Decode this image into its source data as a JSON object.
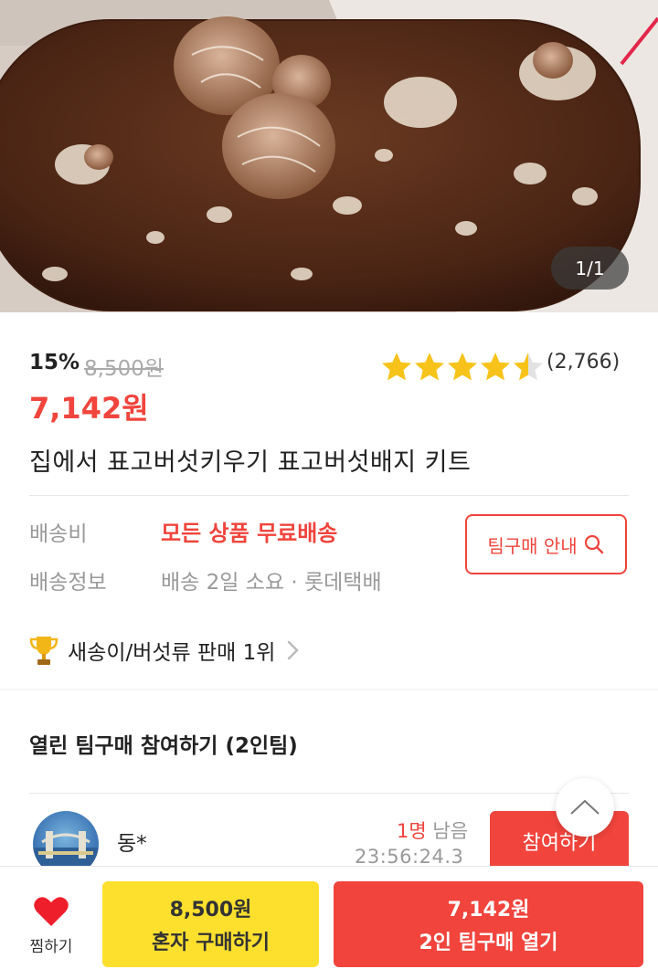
{
  "image": {
    "counter": "1/1"
  },
  "price": {
    "discount": "15%",
    "original": "8,500원",
    "sale": "7,142원"
  },
  "rating": {
    "stars": 4.5,
    "count": "(2,766)",
    "star_color": "#f7c31a"
  },
  "product": {
    "title": "집에서 표고버섯키우기 표고버섯배지 키트"
  },
  "shipping": {
    "fee_label": "배송비",
    "fee_value": "모든 상품 무료배송",
    "info_label": "배송정보",
    "info_value": "배송 2일 소요 · 롯데택배",
    "team_guide": "팀구매 안내"
  },
  "ranking": {
    "text": "새송이/버섯류 판매 1위"
  },
  "team_section": {
    "title": "열린 팀구매 참여하기 (2인팀)",
    "member": "동*",
    "remain_count": "1명",
    "remain_suffix": "남음",
    "timer": "23:56:24.3",
    "join_label": "참여하기"
  },
  "bottom": {
    "wish_label": "찜하기",
    "solo_price": "8,500원",
    "solo_label": "혼자 구매하기",
    "team_price": "7,142원",
    "team_label": "2인 팀구매 열기"
  },
  "colors": {
    "accent": "#f0443c",
    "solo": "#fde02e"
  }
}
